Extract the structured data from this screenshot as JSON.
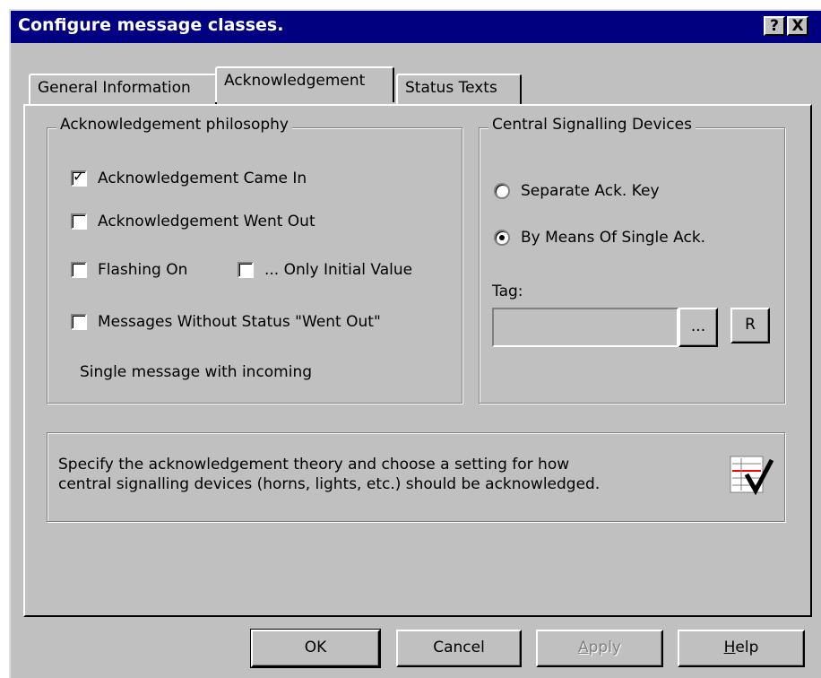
{
  "dialog": {
    "title": "Configure message classes.",
    "help_button": "?",
    "close_button": "X"
  },
  "tabs": [
    {
      "label": "General Information",
      "active": false
    },
    {
      "label": "Acknowledgement",
      "active": true
    },
    {
      "label": "Status Texts",
      "active": false
    }
  ],
  "ack_philosophy": {
    "legend": "Acknowledgement philosophy",
    "came_in": {
      "label": "Acknowledgement Came In",
      "checked": true
    },
    "went_out": {
      "label": "Acknowledgement Went Out",
      "checked": false
    },
    "flashing_on": {
      "label": "Flashing On",
      "checked": false
    },
    "only_initial": {
      "label": "... Only Initial Value",
      "checked": false
    },
    "without_went_out": {
      "label": "Messages Without Status \"Went Out\"",
      "checked": false
    },
    "summary": "Single message with incoming"
  },
  "central_devices": {
    "legend": "Central Signalling Devices",
    "separate_key": {
      "label": "Separate Ack. Key",
      "selected": false
    },
    "single_ack": {
      "label": "By Means Of Single Ack.",
      "selected": true
    },
    "tag_label": "Tag:",
    "tag_value": "",
    "browse_button": "...",
    "r_button": "R"
  },
  "info": {
    "line1": "Specify the acknowledgement theory and choose a setting for how",
    "line2": "central signalling devices (horns, lights, etc.) should be acknowledged."
  },
  "buttons": {
    "ok": "OK",
    "cancel": "Cancel",
    "apply_first": "A",
    "apply_rest": "pply",
    "help_first": "H",
    "help_rest": "elp"
  },
  "colors": {
    "title_bg": "#000080",
    "face": "#c0c0c0"
  }
}
